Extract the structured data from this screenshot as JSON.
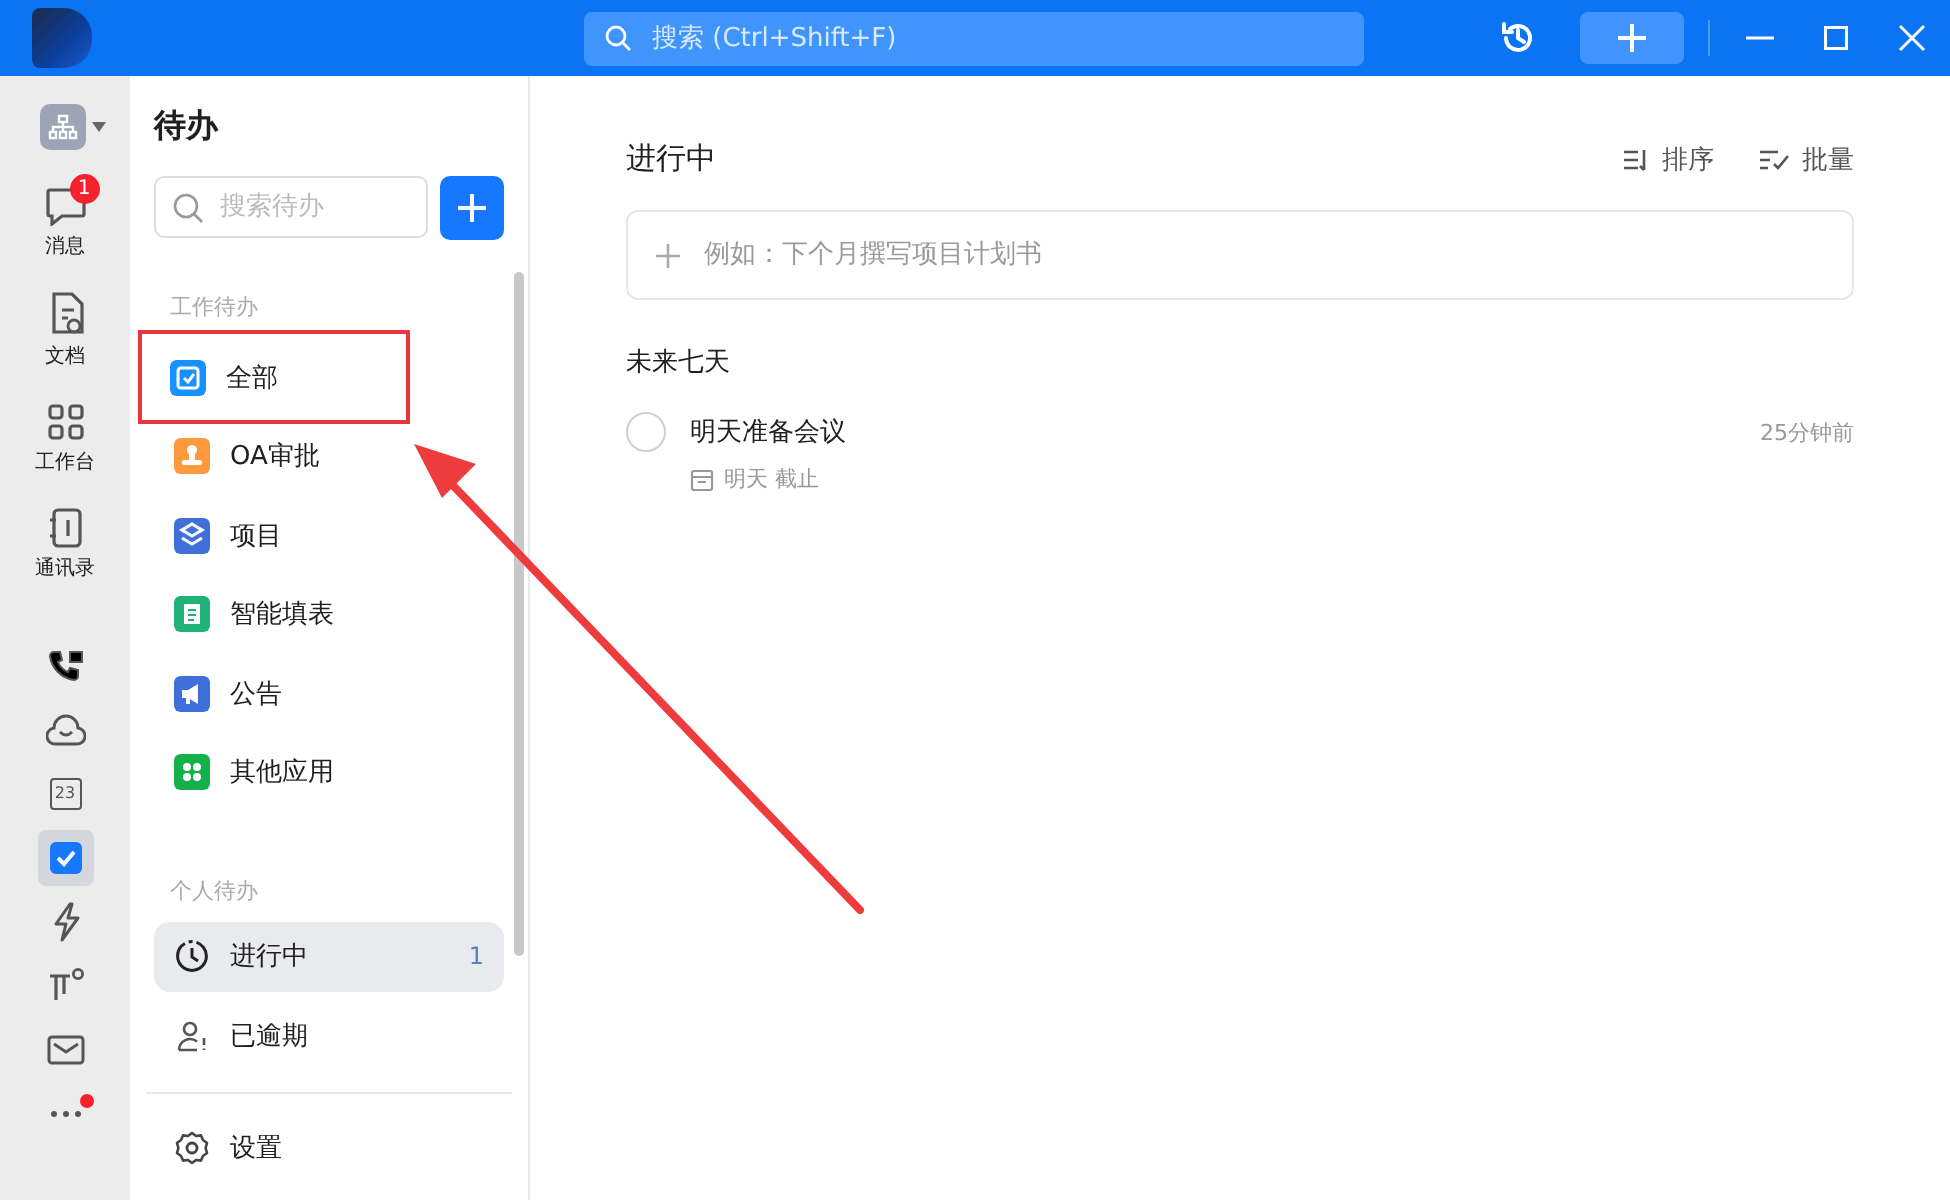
{
  "title_bar": {
    "search": {
      "placeholder": "搜索 (Ctrl+Shift+F)"
    }
  },
  "rail": {
    "items": [
      {
        "kind": "chat",
        "label": "消息",
        "badge": "1",
        "selected": false
      },
      {
        "kind": "doc",
        "label": "文档",
        "selected": false
      },
      {
        "kind": "grid",
        "label": "工作台",
        "selected": false
      },
      {
        "kind": "contacts",
        "label": "通讯录",
        "selected": false
      },
      {
        "kind": "phone",
        "selected": false
      },
      {
        "kind": "cloud",
        "selected": false
      },
      {
        "kind": "calendar",
        "day": "23",
        "selected": false
      },
      {
        "kind": "todo",
        "selected": true
      },
      {
        "kind": "bolt",
        "selected": false
      },
      {
        "kind": "pin",
        "selected": false
      },
      {
        "kind": "mail",
        "selected": false
      },
      {
        "kind": "more",
        "dot": true,
        "selected": false
      }
    ]
  },
  "sidebar": {
    "title": "待办",
    "search": {
      "placeholder": "搜索待办"
    },
    "sections": [
      {
        "title": "工作待办",
        "items": [
          {
            "kind": "check",
            "label": "全部",
            "color": "#1890ff",
            "selected": false,
            "highlighted": true
          },
          {
            "kind": "stamp",
            "label": "OA审批",
            "color": "#ff9a3c",
            "selected": false,
            "highlighted": false
          },
          {
            "kind": "layers",
            "label": "项目",
            "color": "#3f6fd8",
            "selected": false,
            "highlighted": false
          },
          {
            "kind": "form",
            "label": "智能填表",
            "color": "#1fb37a",
            "selected": false,
            "highlighted": false
          },
          {
            "kind": "megaphone",
            "label": "公告",
            "color": "#3f6fd8",
            "selected": false,
            "highlighted": false
          },
          {
            "kind": "apps",
            "label": "其他应用",
            "color": "#14b04a",
            "selected": false,
            "highlighted": false
          }
        ]
      },
      {
        "title": "个人待办",
        "items": [
          {
            "kind": "clock",
            "label": "进行中",
            "count": "1",
            "selected": true,
            "highlighted": false
          },
          {
            "kind": "person",
            "label": "已逾期",
            "selected": false,
            "highlighted": false
          }
        ]
      }
    ],
    "settings": {
      "label": "设置"
    }
  },
  "main": {
    "title": "进行中",
    "actions": [
      {
        "kind": "sort",
        "label": "排序"
      },
      {
        "kind": "batch",
        "label": "批量"
      }
    ],
    "new_task": {
      "placeholder": "例如：下个月撰写项目计划书"
    },
    "groups": [
      {
        "title": "未来七天",
        "tasks": [
          {
            "title": "明天准备会议",
            "done": false,
            "due": "明天 截止",
            "time": "25分钟前"
          }
        ]
      }
    ]
  }
}
